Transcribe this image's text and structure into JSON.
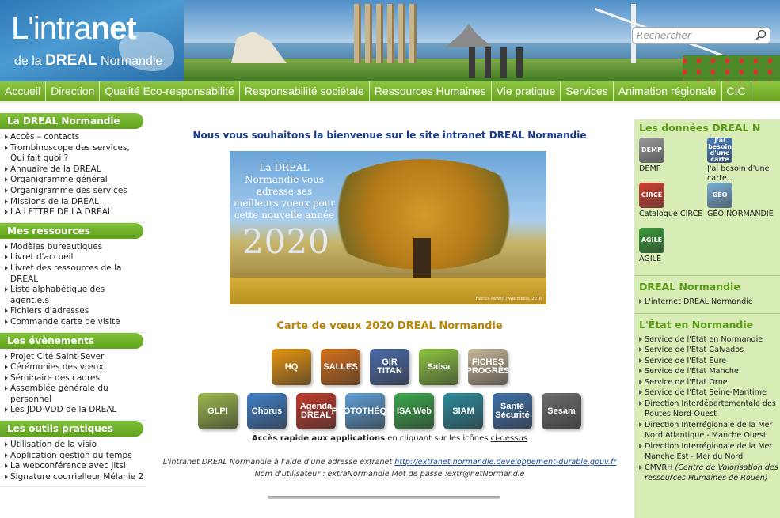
{
  "header": {
    "logo_main": "L'intra",
    "logo_bold": "net",
    "logo_sub_prefix": "de la ",
    "logo_sub_bold": "DREAL",
    "logo_sub_suffix": " Normandie",
    "search_placeholder": "Rechercher"
  },
  "nav": {
    "items": [
      "Accueil",
      "Direction",
      "Qualité Eco-responsabilité",
      "Responsabilité sociétale",
      "Ressources Humaines",
      "Vie pratique",
      "Services",
      "Animation régionale",
      "CIC"
    ]
  },
  "left": {
    "blocks": [
      {
        "title": "La DREAL Normandie",
        "items": [
          "Accès – contacts",
          "Trombinoscope des services, Qui fait quoi ?",
          "Annuaire de la DREAL",
          "Organigramme général",
          "Organigramme des services",
          "Missions de la DREAL",
          "LA LETTRE DE LA DREAL"
        ]
      },
      {
        "title": "Mes ressources",
        "items": [
          "Modèles bureautiques",
          "Livret d'accueil",
          "Livret des ressources de la DREAL",
          "Liste alphabétique des agent.e.s",
          "Fichiers d'adresses",
          "Commande carte de visite"
        ]
      },
      {
        "title": "Les évènements",
        "items": [
          "Projet Cité Saint-Sever",
          "Cérémonies des vœux",
          "Séminaire des cadres",
          "Assemblée générale du personnel",
          "Les JDD-VDD de la DREAL"
        ]
      },
      {
        "title": "Les outils pratiques",
        "items": [
          "Utilisation de la visio",
          "Application gestion du temps",
          "La webconférence avec Jitsi",
          "Signature courrielleur Mélanie 2"
        ]
      }
    ]
  },
  "center": {
    "welcome": "Nous vous souhaitons la bienvenue sur le site intranet DREAL Normandie",
    "card": {
      "greeting": "La DREAL Normandie vous adresse ses meilleurs voeux pour cette nouvelle année",
      "year": "2020",
      "credit": "Fabrice Pavard / Wikimedia, 2016"
    },
    "card_caption": "Carte de vœux 2020 DREAL Normandie",
    "apps_row1": [
      {
        "label": "HQ",
        "color": "#e8940e"
      },
      {
        "label": "SALLES",
        "color": "#d9701a"
      },
      {
        "label": "GIR TITAN",
        "color": "#4a6aa8"
      },
      {
        "label": "Salsa",
        "color": "#8cc63f"
      },
      {
        "label": "FICHES PROGRÈS",
        "color": "#c9b89a"
      }
    ],
    "apps_row2": [
      {
        "label": "GLPI",
        "color": "#9ab84a"
      },
      {
        "label": "Chorus",
        "color": "#3f7ec6"
      },
      {
        "label": "Agenda DREAL",
        "color": "#c0392b"
      },
      {
        "label": "PHOTOTHÈQUE",
        "color": "#5f9ed6"
      },
      {
        "label": "ISA Web",
        "color": "#3aa64a"
      },
      {
        "label": "SIAM",
        "color": "#2a8a9a"
      },
      {
        "label": "Santé Sécurité",
        "color": "#3f6fa8"
      },
      {
        "label": "Sesam",
        "color": "#6a6a6a"
      }
    ],
    "quick_bold": "Accès rapide aux applications",
    "quick_rest": " en cliquant sur les icônes ",
    "quick_link": "ci-dessus",
    "extranet_text": "L'intranet DREAL Normandie à l'aide d'une adresse extranet ",
    "extranet_link": "http://extranet.normandie.developpement-durable.gouv.fr",
    "creds": "Nom d'utilisateur : extraNormandie Mot de passe :extr@netNormandie"
  },
  "right": {
    "title1": "Les données DREAL N",
    "apps": [
      {
        "label": "DEMP",
        "icon": "DEMP",
        "color": "#9a9a9a"
      },
      {
        "label": "J'ai besoin d'une carte…",
        "icon": "J'ai besoin d'une carte",
        "color": "#4a7fc0"
      },
      {
        "label": "Catalogue CIRCE",
        "icon": "CIRCÉ",
        "color": "#d04030"
      },
      {
        "label": "GÉO NORMANDIE",
        "icon": "GÉO",
        "color": "#7ab0d8"
      },
      {
        "label": "AGILE",
        "icon": "AGILE",
        "color": "#3a9a3a"
      }
    ],
    "title2": "DREAL Normandie",
    "list2": [
      "L'internet DREAL Normandie"
    ],
    "title3": "L'État en Normandie",
    "list3": [
      {
        "text": "Service de l'État en Normandie"
      },
      {
        "text": "Service de l'État Calvados"
      },
      {
        "text": "Service de l'État Eure"
      },
      {
        "text": "Service de l'État Manche"
      },
      {
        "text": "Service de l'État Orne"
      },
      {
        "text": "Service de l'État Seine-Maritime"
      },
      {
        "text": "Direction Interdépartementale des Routes Nord-Ouest"
      },
      {
        "text": "Direction Interrégionale de la Mer Nord Atlantique - Manche Ouest"
      },
      {
        "text": "Direction Interrégionale de la Mer Manche Est - Mer du Nord"
      },
      {
        "text": "CMVRH ",
        "italic": "(Centre de Valorisation des ressources Humaines de Rouen)"
      }
    ]
  }
}
